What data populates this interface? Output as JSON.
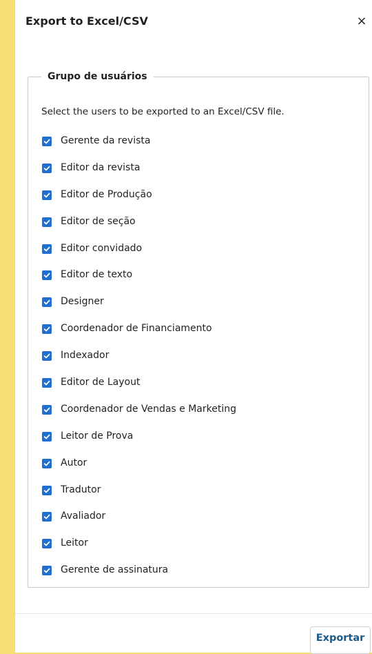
{
  "dialog": {
    "title": "Export to Excel/CSV",
    "close_symbol": "×",
    "group": {
      "legend": "Grupo de usuários",
      "description": "Select the users to be exported to an Excel/CSV file.",
      "options": [
        {
          "label": "Gerente da revista",
          "checked": true
        },
        {
          "label": "Editor da revista",
          "checked": true
        },
        {
          "label": "Editor de Produção",
          "checked": true
        },
        {
          "label": "Editor de seção",
          "checked": true
        },
        {
          "label": "Editor convidado",
          "checked": true
        },
        {
          "label": "Editor de texto",
          "checked": true
        },
        {
          "label": "Designer",
          "checked": true
        },
        {
          "label": "Coordenador de Financiamento",
          "checked": true
        },
        {
          "label": "Indexador",
          "checked": true
        },
        {
          "label": "Editor de Layout",
          "checked": true
        },
        {
          "label": "Coordenador de Vendas e Marketing",
          "checked": true
        },
        {
          "label": "Leitor de Prova",
          "checked": true
        },
        {
          "label": "Autor",
          "checked": true
        },
        {
          "label": "Tradutor",
          "checked": true
        },
        {
          "label": "Avaliador",
          "checked": true
        },
        {
          "label": "Leitor",
          "checked": true
        },
        {
          "label": "Gerente de assinatura",
          "checked": true
        }
      ]
    },
    "export_label": "Exportar"
  },
  "colors": {
    "page_background": "#f7dd72",
    "checkbox": "#1f6fd1",
    "button_text": "#1a5b8c"
  },
  "icons": {
    "close": "close-icon",
    "checkbox": "checkmark-icon"
  }
}
